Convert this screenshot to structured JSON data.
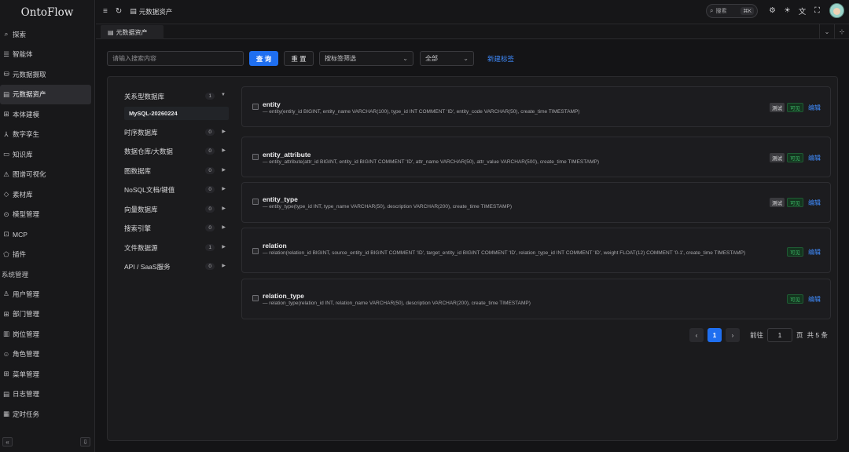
{
  "app": {
    "logo": "OntoFlow"
  },
  "sidebar": {
    "items": [
      {
        "icon": "⌕",
        "label": "探索"
      },
      {
        "icon": "☰",
        "label": "智能体"
      },
      {
        "icon": "⛁",
        "label": "元数据摄取"
      },
      {
        "icon": "▤",
        "label": "元数据资产",
        "active": true
      },
      {
        "icon": "⊞",
        "label": "本体建模"
      },
      {
        "icon": "⅄",
        "label": "数字孪生"
      },
      {
        "icon": "▭",
        "label": "知识库"
      },
      {
        "icon": "⚠",
        "label": "图谱可视化"
      },
      {
        "icon": "◇",
        "label": "素材库"
      },
      {
        "icon": "⊙",
        "label": "模型管理"
      },
      {
        "icon": "⊡",
        "label": "MCP"
      },
      {
        "icon": "⬠",
        "label": "插件"
      }
    ],
    "section_title": "系统管理",
    "system_items": [
      {
        "icon": "♙",
        "label": "用户管理"
      },
      {
        "icon": "⊞",
        "label": "部门管理"
      },
      {
        "icon": "▥",
        "label": "岗位管理"
      },
      {
        "icon": "☺",
        "label": "角色管理"
      },
      {
        "icon": "⊞",
        "label": "菜单管理"
      },
      {
        "icon": "▤",
        "label": "日志管理"
      },
      {
        "icon": "▦",
        "label": "定时任务"
      }
    ],
    "collapse_icon": "«",
    "pin_icon": "⇩"
  },
  "topbar": {
    "menu_icon": "≡",
    "refresh_icon": "↻",
    "breadcrumb_icon": "▤",
    "breadcrumb": "元数据资产",
    "search_label": "搜索",
    "search_kbd": "⌘K",
    "icons": [
      "⚙",
      "☀",
      "文",
      "⛶"
    ]
  },
  "tabs": {
    "active_label": "元数据资产",
    "right_icons": [
      "⌄",
      "⊹"
    ]
  },
  "filters": {
    "search_placeholder": "请输入搜索内容",
    "query_button": "查 询",
    "reset_button": "重 置",
    "tag_filter": "按标签筛选",
    "scope_select": "全部",
    "new_tag_link": "新建标签"
  },
  "categories": [
    {
      "label": "关系型数据库",
      "count": "1",
      "arrow": "▼",
      "expanded": true,
      "children": [
        "MySQL-20260224"
      ]
    },
    {
      "label": "时序数据库",
      "count": "0",
      "arrow": "▶"
    },
    {
      "label": "数据仓库/大数据",
      "count": "0",
      "arrow": "▶"
    },
    {
      "label": "图数据库",
      "count": "0",
      "arrow": "▶"
    },
    {
      "label": "NoSQL文档/键值",
      "count": "0",
      "arrow": "▶"
    },
    {
      "label": "向量数据库",
      "count": "0",
      "arrow": "▶"
    },
    {
      "label": "搜索引擎",
      "count": "0",
      "arrow": "▶"
    },
    {
      "label": "文件数据源",
      "count": "1",
      "arrow": "▶"
    },
    {
      "label": "API / SaaS服务",
      "count": "0",
      "arrow": "▶"
    }
  ],
  "assets": [
    {
      "name": "entity",
      "desc": "— entity(entity_id BIGINT, entity_name VARCHAR(100), type_id INT COMMENT 'ID', entity_code VARCHAR(50), create_time TIMESTAMP)",
      "tags": [
        "测试",
        "可见"
      ],
      "action": "编辑"
    },
    {
      "name": "entity_attribute",
      "desc": "— entity_attribute(attr_id BIGINT, entity_id BIGINT COMMENT 'ID', attr_name VARCHAR(50), attr_value VARCHAR(500), create_time TIMESTAMP)",
      "tags": [
        "测试",
        "可见"
      ],
      "action": "编辑"
    },
    {
      "name": "entity_type",
      "desc": "— entity_type(type_id INT, type_name VARCHAR(50), description VARCHAR(200), create_time TIMESTAMP)",
      "tags": [
        "测试",
        "可见"
      ],
      "action": "编辑"
    },
    {
      "name": "relation",
      "desc": "— relation(relation_id BIGINT, source_entity_id BIGINT COMMENT 'ID', target_entity_id BIGINT COMMENT 'ID', relation_type_id INT COMMENT 'ID', weight FLOAT(12) COMMENT '0-1', create_time TIMESTAMP)",
      "tags": [
        "可见"
      ],
      "action": "编辑"
    },
    {
      "name": "relation_type",
      "desc": "— relation_type(relation_id INT, relation_name VARCHAR(50), description VARCHAR(200), create_time TIMESTAMP)",
      "tags": [
        "可见"
      ],
      "action": "编辑"
    }
  ],
  "pagination": {
    "prev": "‹",
    "next": "›",
    "current": "1",
    "goto_label": "前往",
    "goto_value": "1",
    "page_unit": "页",
    "total": "共 5 条"
  }
}
